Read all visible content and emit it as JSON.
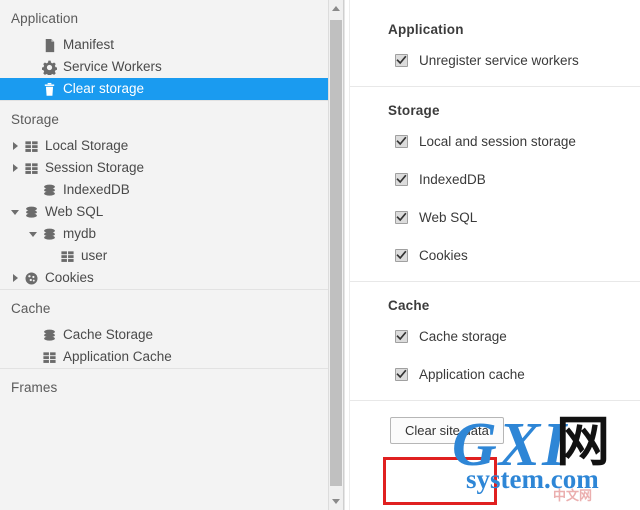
{
  "tree": {
    "sections": [
      {
        "name": "application",
        "title": "Application",
        "items": [
          {
            "label": "Manifest",
            "icon": "document-icon",
            "twisty": "none",
            "indent": 2,
            "selected": false
          },
          {
            "label": "Service Workers",
            "icon": "gear-icon",
            "twisty": "none",
            "indent": 2,
            "selected": false
          },
          {
            "label": "Clear storage",
            "icon": "trash-icon",
            "twisty": "none",
            "indent": 2,
            "selected": true
          }
        ]
      },
      {
        "name": "storage",
        "title": "Storage",
        "items": [
          {
            "label": "Local Storage",
            "icon": "table-icon",
            "twisty": "collapsed",
            "indent": 1,
            "selected": false
          },
          {
            "label": "Session Storage",
            "icon": "table-icon",
            "twisty": "collapsed",
            "indent": 1,
            "selected": false
          },
          {
            "label": "IndexedDB",
            "icon": "database-icon",
            "twisty": "none",
            "indent": 2,
            "selected": false
          },
          {
            "label": "Web SQL",
            "icon": "database-icon",
            "twisty": "expanded",
            "indent": 1,
            "selected": false
          },
          {
            "label": "mydb",
            "icon": "database-icon",
            "twisty": "expanded",
            "indent": 2,
            "selected": false
          },
          {
            "label": "user",
            "icon": "table-icon",
            "twisty": "none",
            "indent": 3,
            "selected": false
          },
          {
            "label": "Cookies",
            "icon": "cookie-icon",
            "twisty": "collapsed",
            "indent": 1,
            "selected": false
          }
        ]
      },
      {
        "name": "cache",
        "title": "Cache",
        "items": [
          {
            "label": "Cache Storage",
            "icon": "database-icon",
            "twisty": "none",
            "indent": 2,
            "selected": false
          },
          {
            "label": "Application Cache",
            "icon": "table-icon",
            "twisty": "none",
            "indent": 2,
            "selected": false
          }
        ]
      },
      {
        "name": "frames",
        "title": "Frames",
        "items": []
      }
    ]
  },
  "clear_storage": {
    "groups": [
      {
        "name": "application",
        "title": "Application",
        "options": [
          {
            "label": "Unregister service workers",
            "checked": true
          }
        ]
      },
      {
        "name": "storage",
        "title": "Storage",
        "options": [
          {
            "label": "Local and session storage",
            "checked": true
          },
          {
            "label": "IndexedDB",
            "checked": true
          },
          {
            "label": "Web SQL",
            "checked": true
          },
          {
            "label": "Cookies",
            "checked": true
          }
        ]
      },
      {
        "name": "cache",
        "title": "Cache",
        "options": [
          {
            "label": "Cache storage",
            "checked": true
          },
          {
            "label": "Application cache",
            "checked": true
          }
        ]
      }
    ],
    "clear_button_label": "Clear site data",
    "highlight_color": "#e02020"
  },
  "watermark": {
    "gxi": "GXI",
    "wang": "网",
    "system": "system.com",
    "cn": "中文网"
  }
}
